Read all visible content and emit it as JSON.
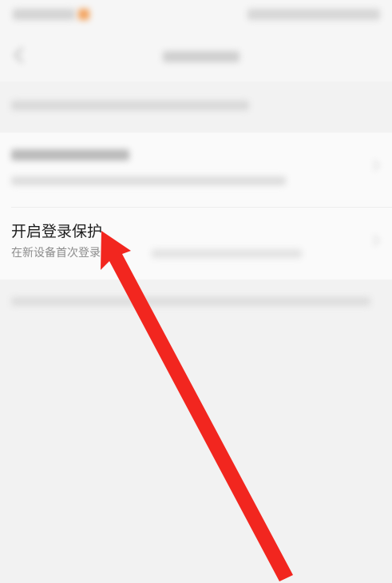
{
  "settings": {
    "login_protection": {
      "title": "开启登录保护",
      "subtitle": "在新设备首次登录时"
    }
  },
  "colors": {
    "annotation_arrow": "#f2261f",
    "title_text": "#1c1c1c",
    "subtitle_text": "#8c8c8c"
  },
  "icons": {
    "back": "back-icon",
    "chevron": "chevron-right-icon"
  }
}
